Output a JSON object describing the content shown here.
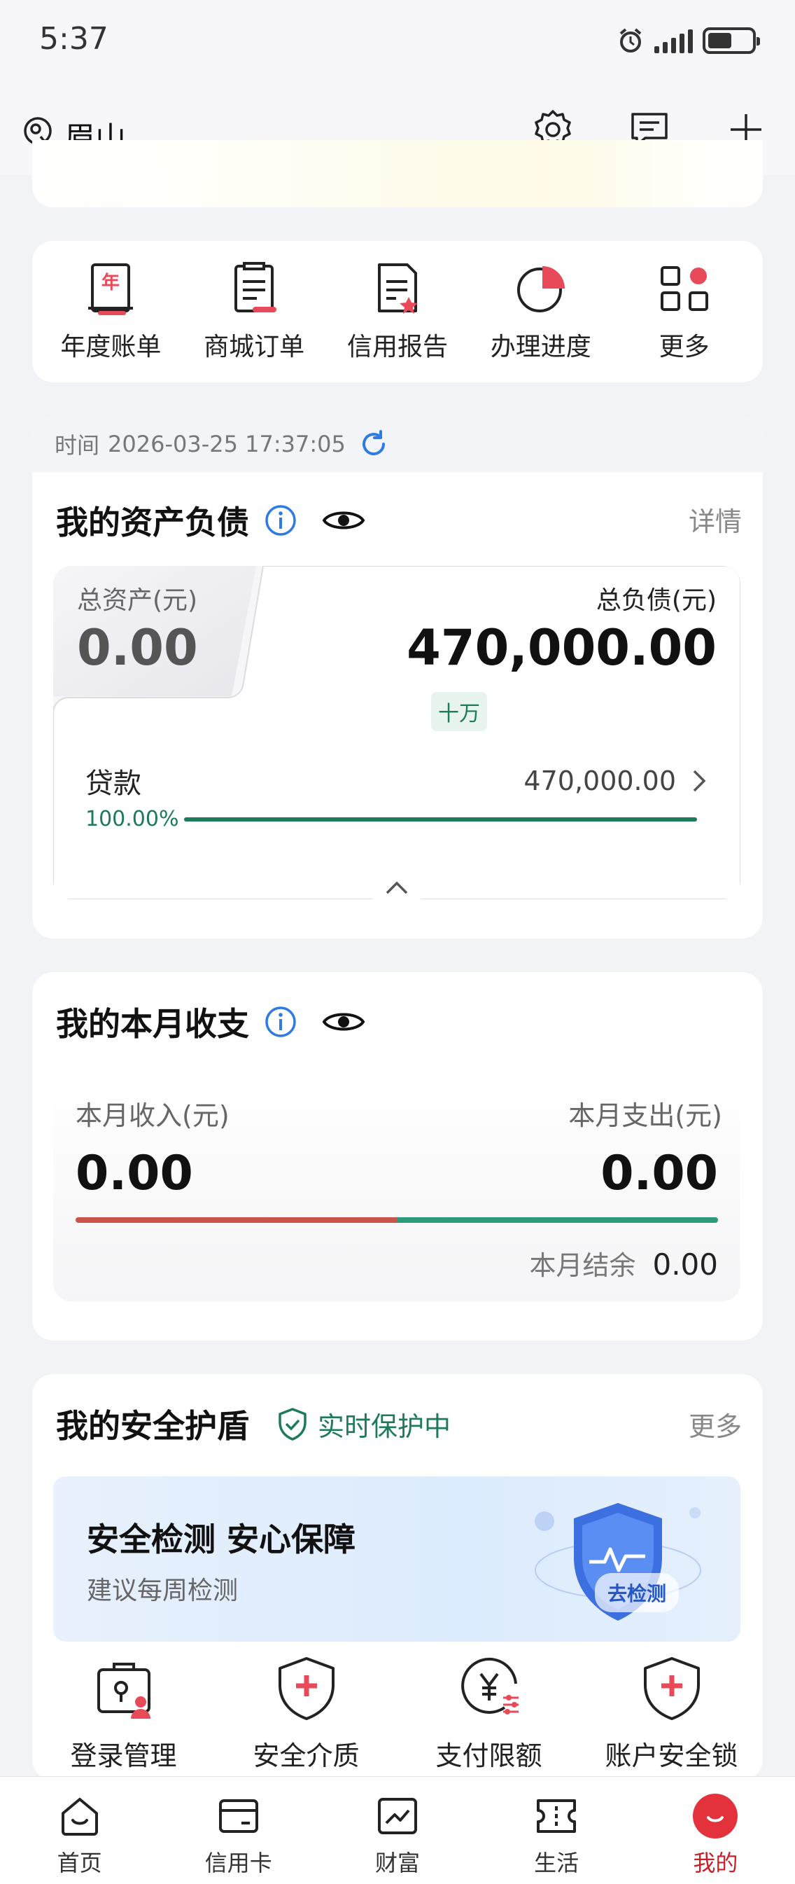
{
  "status_bar": {
    "time": "5:37",
    "signal_tag": "᪥"
  },
  "header": {
    "city": "眉山"
  },
  "quick_actions": [
    {
      "label": "年度账单",
      "icon": "annual-bill-icon"
    },
    {
      "label": "商城订单",
      "icon": "mall-order-icon"
    },
    {
      "label": "信用报告",
      "icon": "credit-report-icon"
    },
    {
      "label": "办理进度",
      "icon": "progress-pie-icon"
    },
    {
      "label": "更多",
      "icon": "more-grid-icon"
    }
  ],
  "assets": {
    "time_label": "时间",
    "time_value": "2026-03-25 17:37:05",
    "title": "我的资产负债",
    "detail_link": "详情",
    "total_assets_label": "总资产(元)",
    "total_assets": "0.00",
    "total_liabilities_label": "总负债(元)",
    "total_liabilities": "470,000.00",
    "magnitude_tag": "十万",
    "loan_label": "贷款",
    "loan_value": "470,000.00",
    "loan_percent": "100.00%",
    "loan_fraction": 1.0
  },
  "income": {
    "title": "我的本月收支",
    "income_label": "本月收入(元)",
    "income_value": "0.00",
    "expense_label": "本月支出(元)",
    "expense_value": "0.00",
    "balance_label": "本月结余",
    "balance_value": "0.00",
    "income_share": 0.5
  },
  "security": {
    "title": "我的安全护盾",
    "status": "实时保护中",
    "more_link": "更多",
    "banner_title": "安全检测 安心保障",
    "banner_sub": "建议每周检测",
    "banner_button": "去检测",
    "tools": [
      {
        "label": "登录管理",
        "icon": "login-manage-icon"
      },
      {
        "label": "安全介质",
        "icon": "security-medium-icon"
      },
      {
        "label": "支付限额",
        "icon": "payment-limit-icon"
      },
      {
        "label": "账户安全锁",
        "icon": "account-lock-icon"
      }
    ]
  },
  "bottom_nav": [
    {
      "label": "首页",
      "icon": "home-icon"
    },
    {
      "label": "信用卡",
      "icon": "credit-card-icon"
    },
    {
      "label": "财富",
      "icon": "wealth-chart-icon"
    },
    {
      "label": "生活",
      "icon": "ticket-icon"
    },
    {
      "label": "我的",
      "icon": "profile-icon",
      "active": true
    }
  ],
  "colors": {
    "brand_red": "#c8202b",
    "green": "#1d7a5a",
    "accent_blue": "#2f7be5"
  }
}
